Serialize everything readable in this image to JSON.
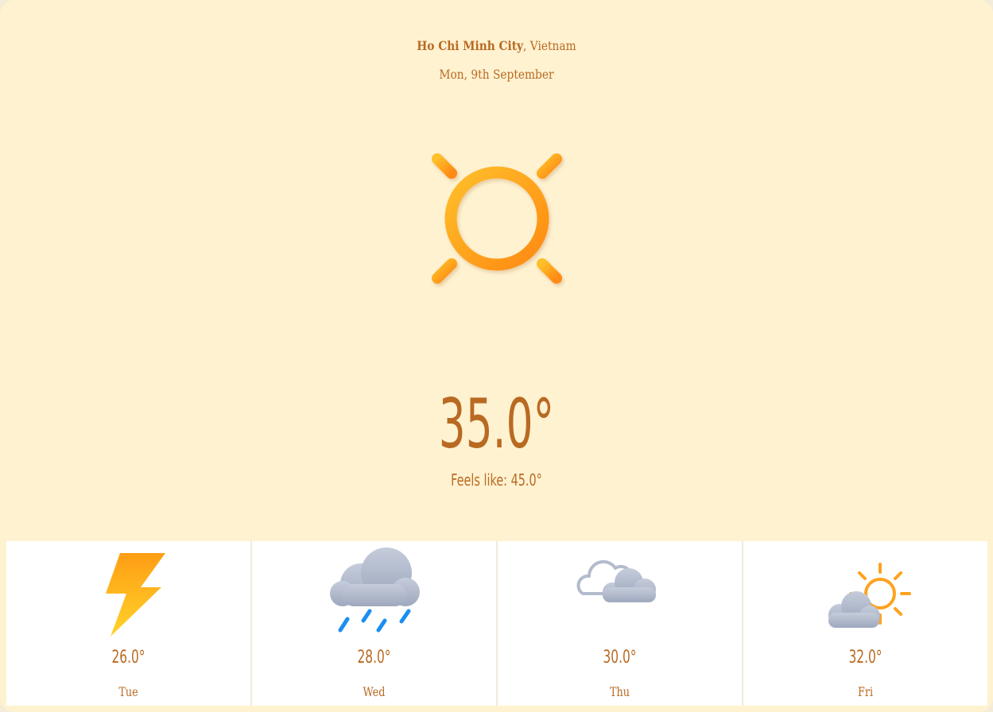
{
  "location": {
    "city": "Ho Chi Minh City",
    "separator": ", ",
    "country": "Vietnam"
  },
  "date": "Mon, 9th September",
  "current": {
    "icon": "sun-icon",
    "temperature": "35.0°",
    "feels_like": "Feels like: 45.0°"
  },
  "forecast": [
    {
      "day": "Tue",
      "temp": "26.0°",
      "icon": "lightning-icon"
    },
    {
      "day": "Wed",
      "temp": "28.0°",
      "icon": "rain-cloud-icon"
    },
    {
      "day": "Thu",
      "temp": "30.0°",
      "icon": "cloudy-icon"
    },
    {
      "day": "Fri",
      "temp": "32.0°",
      "icon": "partly-sunny-icon"
    }
  ],
  "colors": {
    "background": "#fff2d1",
    "text": "#b96a22",
    "sun": "#ffa21f",
    "cloud": "#a8b2c6",
    "rain": "#1b8ef0",
    "panel": "#ffffff"
  }
}
